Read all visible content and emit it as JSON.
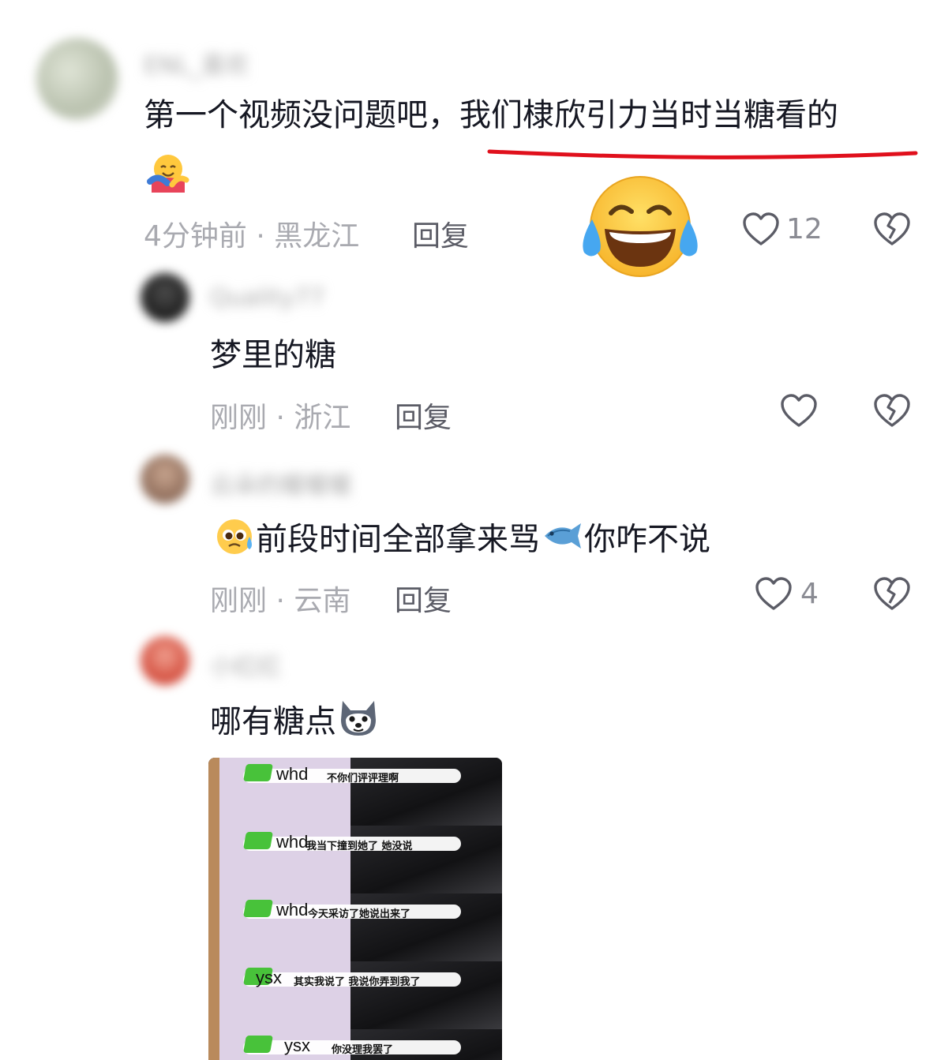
{
  "comments": [
    {
      "username": "ENL_喜欢",
      "text": "第一个视频没问题吧，",
      "text_highlight": "我们棣欣引力当时当糖看的",
      "time": "4分钟前",
      "location": "黑龙江",
      "reply_label": "回复",
      "like_count": "12"
    },
    {
      "username": "Qu​al​ity77",
      "text": "梦里的糖",
      "time": "刚刚",
      "location": "浙江",
      "reply_label": "回复",
      "like_count": ""
    },
    {
      "username": "云朵的暖暖暖",
      "text": "前段时间全部拿来骂",
      "text2": "你咋不说",
      "time": "刚刚",
      "location": "云南",
      "reply_label": "回复",
      "like_count": "4"
    },
    {
      "username": "小红红",
      "text": "哪有糖点",
      "time": "",
      "location": "",
      "reply_label": "",
      "like_count": ""
    }
  ],
  "separator": " · ",
  "image_captions": [
    {
      "speaker": "whd",
      "caption": "不你们评评理啊"
    },
    {
      "speaker": "whd",
      "caption": "我当下撞到她了 她没说"
    },
    {
      "speaker": "whd",
      "caption": "今天采访了她说出来了"
    },
    {
      "speaker": "ysx",
      "caption": "其实我说了 我说你弄到我了"
    },
    {
      "speaker": "ysx",
      "caption": "你没理我罢了"
    }
  ],
  "icons": [
    "heart-outline-icon",
    "broken-heart-icon",
    "hug-emoji-icon",
    "tears-of-joy-emoji-icon",
    "pleading-emoji-icon",
    "fish-emoji-icon",
    "husky-emoji-icon"
  ],
  "colors": {
    "highlight_underline": "#e0101c",
    "meta": "#a9aab0",
    "reply": "#5b5c66",
    "text": "#161823"
  }
}
